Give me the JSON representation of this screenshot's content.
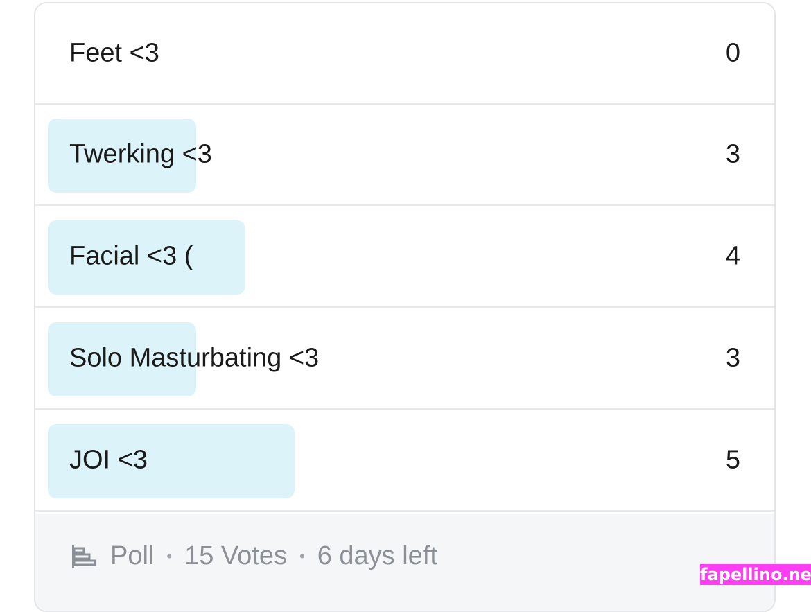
{
  "poll": {
    "options": [
      {
        "label": "Feet <3",
        "votes": "0",
        "fill": 0
      },
      {
        "label": "Twerking <3",
        "votes": "3",
        "fill": 0.6
      },
      {
        "label": "Facial <3 (",
        "votes": "4",
        "fill": 0.8
      },
      {
        "label": "Solo Masturbating <3",
        "votes": "3",
        "fill": 0.6
      },
      {
        "label": "JOI <3",
        "votes": "5",
        "fill": 1.0
      }
    ],
    "footer": {
      "icon": "poll-bars-icon",
      "type_label": "Poll",
      "votes_label": "15 Votes",
      "time_label": "6 days left",
      "separator": "•"
    }
  },
  "colors": {
    "bar_fill": "#dcf4f9",
    "footer_bg": "#f5f6f8",
    "muted_text": "#8a9096"
  },
  "watermark": "fapellino.net"
}
